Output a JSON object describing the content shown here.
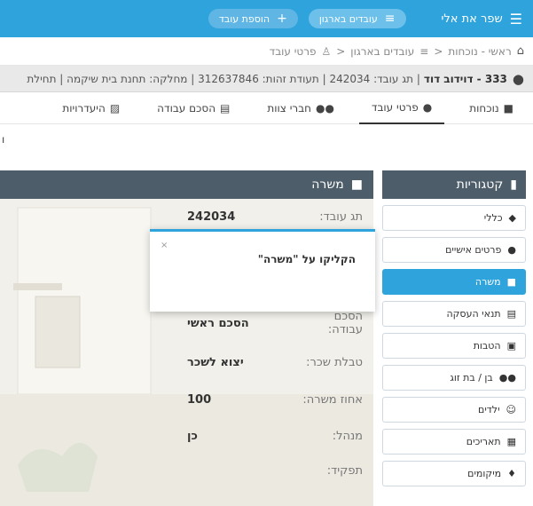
{
  "topbar": {
    "brand": "שפר את אלי",
    "filter_label": "עובדים בארגון",
    "add_label": "הוספת עובד"
  },
  "breadcrumb": [
    "ראשי - נוכחות",
    "עובדים בארגון",
    "פרטי עובד"
  ],
  "employee": {
    "code": "333 - דוידוב דוד",
    "details": "| תג עובד: 242034 | תעודת זהות: 312637846 | מחלקה: תחנת בית שיקמה | תחילת"
  },
  "tabs": [
    {
      "label": "נוכחות",
      "icon": "briefcase-icon"
    },
    {
      "label": "פרטי עובד",
      "icon": "user-icon"
    },
    {
      "label": "חברי צוות",
      "icon": "team-icon"
    },
    {
      "label": "הסכם עבודה",
      "icon": "document-icon"
    },
    {
      "label": "היעדרויות",
      "icon": "calendar-off-icon"
    }
  ],
  "edge_letter": "ו",
  "sidebar": {
    "title": "קטגוריות",
    "items": [
      {
        "label": "כללי",
        "icon": "layers-icon"
      },
      {
        "label": "פרטים אישיים",
        "icon": "user-icon"
      },
      {
        "label": "משרה",
        "icon": "briefcase-icon"
      },
      {
        "label": "תנאי העסקה",
        "icon": "document-icon"
      },
      {
        "label": "הטבות",
        "icon": "gift-icon"
      },
      {
        "label": "בן / בת זוג",
        "icon": "couple-icon"
      },
      {
        "label": "ילדים",
        "icon": "child-icon"
      },
      {
        "label": "תאריכים",
        "icon": "calendar-icon"
      },
      {
        "label": "מיקומים",
        "icon": "location-icon"
      }
    ],
    "active_index": 2
  },
  "panel": {
    "title": "משרה",
    "rows": [
      {
        "label": "תג עובד:",
        "value": "242034"
      },
      {
        "label": "הסכם עבודה:",
        "value": "הסכם ראשי"
      },
      {
        "label": "טבלת שכר:",
        "value": "יצוא לשכר"
      },
      {
        "label": "אחוז משרה:",
        "value": "100"
      },
      {
        "label": "מנהל:",
        "value": "כן"
      },
      {
        "label": "תפקיד:",
        "value": ""
      }
    ]
  },
  "tooltip": {
    "message": "הקליקו על \"משרה\"",
    "close": "×"
  },
  "colors": {
    "accent": "#2ea3dc",
    "header_dark": "#4d5d6a"
  }
}
